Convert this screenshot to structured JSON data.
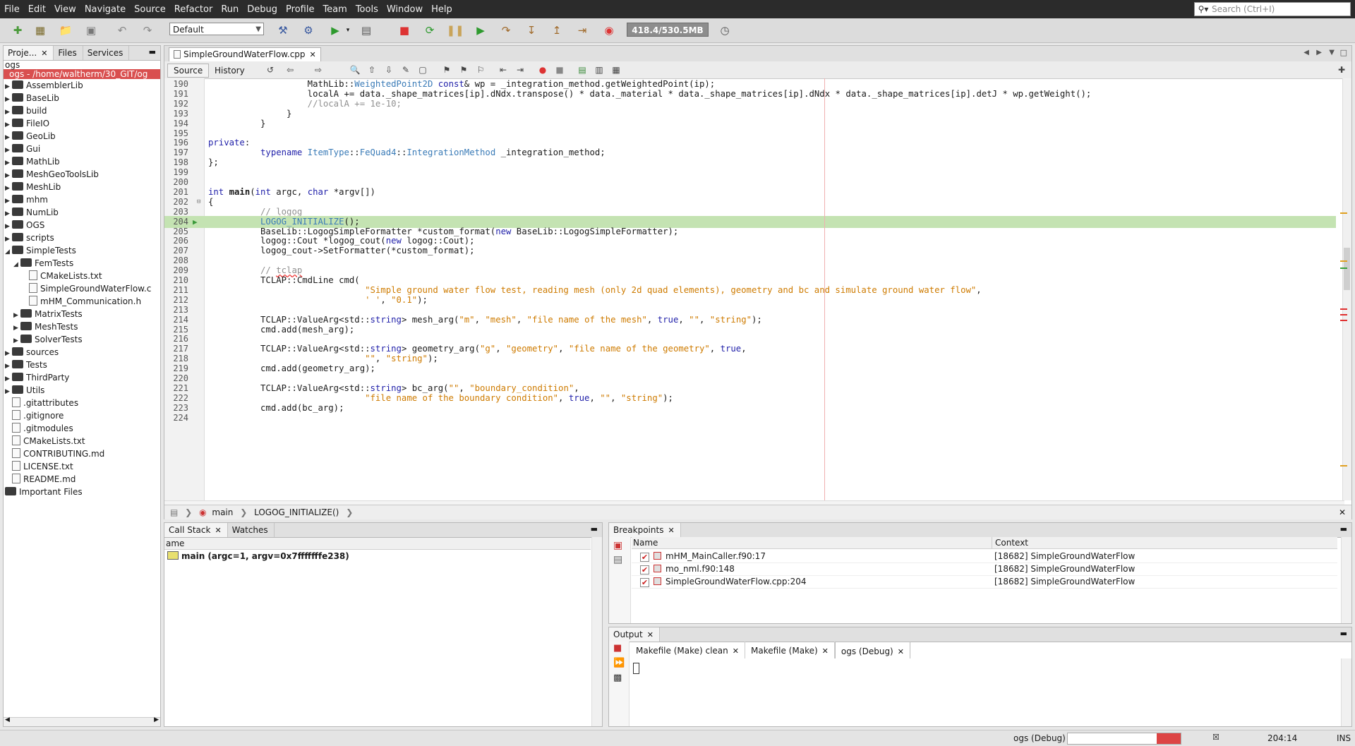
{
  "menu": [
    "File",
    "Edit",
    "View",
    "Navigate",
    "Source",
    "Refactor",
    "Run",
    "Debug",
    "Profile",
    "Team",
    "Tools",
    "Window",
    "Help"
  ],
  "search": {
    "placeholder": "Search (Ctrl+I)"
  },
  "toolbar": {
    "config": "Default",
    "memory": "418.4/530.5MB"
  },
  "project_tabs": [
    "Proje...",
    "Files",
    "Services"
  ],
  "tree": {
    "header": "ogs",
    "root": "ogs - /home/waltherm/30_GIT/og",
    "items": [
      {
        "label": "AssemblerLib",
        "kind": "folder",
        "depth": 0,
        "expanded": false
      },
      {
        "label": "BaseLib",
        "kind": "folder",
        "depth": 0,
        "expanded": false
      },
      {
        "label": "build",
        "kind": "folder",
        "depth": 0,
        "expanded": false
      },
      {
        "label": "FileIO",
        "kind": "folder",
        "depth": 0,
        "expanded": false
      },
      {
        "label": "GeoLib",
        "kind": "folder",
        "depth": 0,
        "expanded": false
      },
      {
        "label": "Gui",
        "kind": "folder",
        "depth": 0,
        "expanded": false
      },
      {
        "label": "MathLib",
        "kind": "folder",
        "depth": 0,
        "expanded": false
      },
      {
        "label": "MeshGeoToolsLib",
        "kind": "folder",
        "depth": 0,
        "expanded": false
      },
      {
        "label": "MeshLib",
        "kind": "folder",
        "depth": 0,
        "expanded": false
      },
      {
        "label": "mhm",
        "kind": "folder",
        "depth": 0,
        "expanded": false
      },
      {
        "label": "NumLib",
        "kind": "folder",
        "depth": 0,
        "expanded": false
      },
      {
        "label": "OGS",
        "kind": "folder",
        "depth": 0,
        "expanded": false
      },
      {
        "label": "scripts",
        "kind": "folder",
        "depth": 0,
        "expanded": false
      },
      {
        "label": "SimpleTests",
        "kind": "folder",
        "depth": 0,
        "expanded": true
      },
      {
        "label": "FemTests",
        "kind": "folder",
        "depth": 1,
        "expanded": true
      },
      {
        "label": "CMakeLists.txt",
        "kind": "file",
        "depth": 2
      },
      {
        "label": "SimpleGroundWaterFlow.c",
        "kind": "file",
        "depth": 2
      },
      {
        "label": "mHM_Communication.h",
        "kind": "file",
        "depth": 2
      },
      {
        "label": "MatrixTests",
        "kind": "folder",
        "depth": 1,
        "expanded": false
      },
      {
        "label": "MeshTests",
        "kind": "folder",
        "depth": 1,
        "expanded": false
      },
      {
        "label": "SolverTests",
        "kind": "folder",
        "depth": 1,
        "expanded": false
      },
      {
        "label": "sources",
        "kind": "folder",
        "depth": 0,
        "expanded": false
      },
      {
        "label": "Tests",
        "kind": "folder",
        "depth": 0,
        "expanded": false
      },
      {
        "label": "ThirdParty",
        "kind": "folder",
        "depth": 0,
        "expanded": false
      },
      {
        "label": "Utils",
        "kind": "folder",
        "depth": 0,
        "expanded": false
      },
      {
        "label": ".gitattributes",
        "kind": "file",
        "depth": 0
      },
      {
        "label": ".gitignore",
        "kind": "file",
        "depth": 0
      },
      {
        "label": ".gitmodules",
        "kind": "file",
        "depth": 0
      },
      {
        "label": "CMakeLists.txt",
        "kind": "file",
        "depth": 0
      },
      {
        "label": "CONTRIBUTING.md",
        "kind": "file",
        "depth": 0
      },
      {
        "label": "LICENSE.txt",
        "kind": "file",
        "depth": 0
      },
      {
        "label": "README.md",
        "kind": "file",
        "depth": 0
      },
      {
        "label": "Important Files",
        "kind": "folder",
        "depth": -1
      }
    ]
  },
  "editor": {
    "tab": "SimpleGroundWaterFlow.cpp",
    "source_btn": "Source",
    "history_btn": "History",
    "highlight_line": "204",
    "lines": [
      {
        "n": "190",
        "segs": [
          [
            "",
            "                   MathLib::"
          ],
          [
            "ty",
            "WeightedPoint2D"
          ],
          [
            "kw",
            " const"
          ],
          [
            "",
            "& wp = "
          ],
          [
            "",
            "_integration_method"
          ],
          [
            "",
            ".getWeightedPoint(ip);"
          ]
        ]
      },
      {
        "n": "191",
        "segs": [
          [
            "",
            "                   localA += data."
          ],
          [
            "",
            "_shape_matrices"
          ],
          [
            "",
            "[ip]."
          ],
          [
            "",
            "dNdx"
          ],
          [
            "",
            ".transpose() * data."
          ],
          [
            "",
            "_material"
          ],
          [
            "",
            " * data."
          ],
          [
            "",
            "_shape_matrices"
          ],
          [
            "",
            "[ip]."
          ],
          [
            "",
            "dNdx"
          ],
          [
            "",
            " * data."
          ],
          [
            "",
            "_shape_matrices"
          ],
          [
            "",
            "[ip]."
          ],
          [
            "",
            "detJ"
          ],
          [
            "",
            " * wp.getWeight();"
          ]
        ]
      },
      {
        "n": "192",
        "segs": [
          [
            "cm",
            "                   //localA += 1e-10;"
          ]
        ]
      },
      {
        "n": "193",
        "segs": [
          [
            "",
            "               }"
          ]
        ]
      },
      {
        "n": "194",
        "segs": [
          [
            "",
            "          }"
          ]
        ]
      },
      {
        "n": "195",
        "segs": [
          [
            "",
            ""
          ]
        ]
      },
      {
        "n": "196",
        "segs": [
          [
            "kw",
            "private"
          ],
          [
            "",
            ":"
          ]
        ]
      },
      {
        "n": "197",
        "segs": [
          [
            "kw",
            "          typename"
          ],
          [
            "ty",
            " ItemType"
          ],
          [
            "",
            "::"
          ],
          [
            "ty",
            "FeQuad4"
          ],
          [
            "",
            "::"
          ],
          [
            "ty",
            "IntegrationMethod"
          ],
          [
            "",
            " _integration_method;"
          ]
        ]
      },
      {
        "n": "198",
        "segs": [
          [
            "",
            "};"
          ]
        ]
      },
      {
        "n": "199",
        "segs": [
          [
            "",
            ""
          ]
        ]
      },
      {
        "n": "200",
        "segs": [
          [
            "",
            ""
          ]
        ]
      },
      {
        "n": "201",
        "segs": [
          [
            "kw",
            "int"
          ],
          [
            "bold",
            " main"
          ],
          [
            "",
            "("
          ],
          [
            "kw",
            "int"
          ],
          [
            "",
            " argc, "
          ],
          [
            "kw",
            "char"
          ],
          [
            "",
            " *argv[])"
          ]
        ]
      },
      {
        "n": "202",
        "segs": [
          [
            "",
            "{"
          ]
        ]
      },
      {
        "n": "203",
        "segs": [
          [
            "cm",
            "          // "
          ],
          [
            "cm wavy",
            "logog"
          ]
        ]
      },
      {
        "n": "204",
        "segs": [
          [
            "ty",
            "          LOGOG_INITIALIZE"
          ],
          [
            "",
            "();"
          ]
        ]
      },
      {
        "n": "205",
        "segs": [
          [
            "",
            "          BaseLib::LogogSimpleFormatter *custom_format("
          ],
          [
            "kw",
            "new"
          ],
          [
            "",
            " BaseLib::LogogSimpleFormatter);"
          ]
        ]
      },
      {
        "n": "206",
        "segs": [
          [
            "",
            "          logog::Cout *logog_cout("
          ],
          [
            "kw",
            "new"
          ],
          [
            "",
            " logog::Cout);"
          ]
        ]
      },
      {
        "n": "207",
        "segs": [
          [
            "",
            "          logog_cout->SetFormatter(*custom_format);"
          ]
        ]
      },
      {
        "n": "208",
        "segs": [
          [
            "",
            ""
          ]
        ]
      },
      {
        "n": "209",
        "segs": [
          [
            "cm",
            "          // "
          ],
          [
            "cm wavy",
            "tclap"
          ]
        ]
      },
      {
        "n": "210",
        "segs": [
          [
            "",
            "          TCLAP::CmdLine cmd("
          ]
        ]
      },
      {
        "n": "211",
        "segs": [
          [
            "st",
            "                              \"Simple ground water flow test, reading mesh (only 2d quad elements), geometry and bc and simulate ground water flow\""
          ],
          [
            "",
            ","
          ]
        ]
      },
      {
        "n": "212",
        "segs": [
          [
            "st",
            "                              ' '"
          ],
          [
            "",
            ", "
          ],
          [
            "st",
            "\"0.1\""
          ],
          [
            "",
            ");"
          ]
        ]
      },
      {
        "n": "213",
        "segs": [
          [
            "",
            ""
          ]
        ]
      },
      {
        "n": "214",
        "segs": [
          [
            "",
            "          TCLAP::ValueArg<std::"
          ],
          [
            "kw",
            "string"
          ],
          [
            "",
            "> mesh_arg("
          ],
          [
            "st",
            "\"m\""
          ],
          [
            "",
            ", "
          ],
          [
            "st",
            "\"mesh\""
          ],
          [
            "",
            ", "
          ],
          [
            "st",
            "\"file name of the mesh\""
          ],
          [
            "",
            ", "
          ],
          [
            "kw",
            "true"
          ],
          [
            "",
            ", "
          ],
          [
            "st",
            "\"\""
          ],
          [
            "",
            ", "
          ],
          [
            "st",
            "\"string\""
          ],
          [
            "",
            ");"
          ]
        ]
      },
      {
        "n": "215",
        "segs": [
          [
            "",
            "          cmd.add(mesh_arg);"
          ]
        ]
      },
      {
        "n": "216",
        "segs": [
          [
            "",
            ""
          ]
        ]
      },
      {
        "n": "217",
        "segs": [
          [
            "",
            "          TCLAP::ValueArg<std::"
          ],
          [
            "kw",
            "string"
          ],
          [
            "",
            "> geometry_arg("
          ],
          [
            "st",
            "\"g\""
          ],
          [
            "",
            ", "
          ],
          [
            "st",
            "\"geometry\""
          ],
          [
            "",
            ", "
          ],
          [
            "st",
            "\"file name of the geometry\""
          ],
          [
            "",
            ", "
          ],
          [
            "kw",
            "true"
          ],
          [
            "",
            ","
          ]
        ]
      },
      {
        "n": "218",
        "segs": [
          [
            "st",
            "                              \"\""
          ],
          [
            "",
            ", "
          ],
          [
            "st",
            "\"string\""
          ],
          [
            "",
            ");"
          ]
        ]
      },
      {
        "n": "219",
        "segs": [
          [
            "",
            "          cmd.add(geometry_arg);"
          ]
        ]
      },
      {
        "n": "220",
        "segs": [
          [
            "",
            ""
          ]
        ]
      },
      {
        "n": "221",
        "segs": [
          [
            "",
            "          TCLAP::ValueArg<std::"
          ],
          [
            "kw",
            "string"
          ],
          [
            "",
            "> bc_arg("
          ],
          [
            "st",
            "\"\""
          ],
          [
            "",
            ", "
          ],
          [
            "st",
            "\"boundary_condition\""
          ],
          [
            "",
            ","
          ]
        ]
      },
      {
        "n": "222",
        "segs": [
          [
            "st",
            "                              \"file name of the boundary condition\""
          ],
          [
            "",
            ", "
          ],
          [
            "kw",
            "true"
          ],
          [
            "",
            ", "
          ],
          [
            "st",
            "\"\""
          ],
          [
            "",
            ", "
          ],
          [
            "st",
            "\"string\""
          ],
          [
            "",
            ");"
          ]
        ]
      },
      {
        "n": "223",
        "segs": [
          [
            "",
            "          cmd.add(bc_arg);"
          ]
        ]
      },
      {
        "n": "224",
        "segs": [
          [
            "",
            ""
          ]
        ]
      }
    ],
    "breadcrumb": [
      "main",
      "LOGOG_INITIALIZE()"
    ]
  },
  "callstack": {
    "tabs": [
      "Call Stack",
      "Watches"
    ],
    "column": "ame",
    "row": "main (argc=1, argv=0x7fffffffe238)"
  },
  "breakpoints": {
    "tab": "Breakpoints",
    "columns": [
      "Name",
      "Context"
    ],
    "rows": [
      {
        "name": "mHM_MainCaller.f90:17",
        "context": "[18682] SimpleGroundWaterFlow"
      },
      {
        "name": "mo_nml.f90:148",
        "context": "[18682] SimpleGroundWaterFlow"
      },
      {
        "name": "SimpleGroundWaterFlow.cpp:204",
        "context": "[18682] SimpleGroundWaterFlow"
      }
    ]
  },
  "output": {
    "tab": "Output",
    "subtabs": [
      "Makefile (Make) clean",
      "Makefile (Make)",
      "ogs (Debug)"
    ]
  },
  "status": {
    "session": "ogs (Debug)",
    "position": "204:14",
    "mode": "INS"
  }
}
